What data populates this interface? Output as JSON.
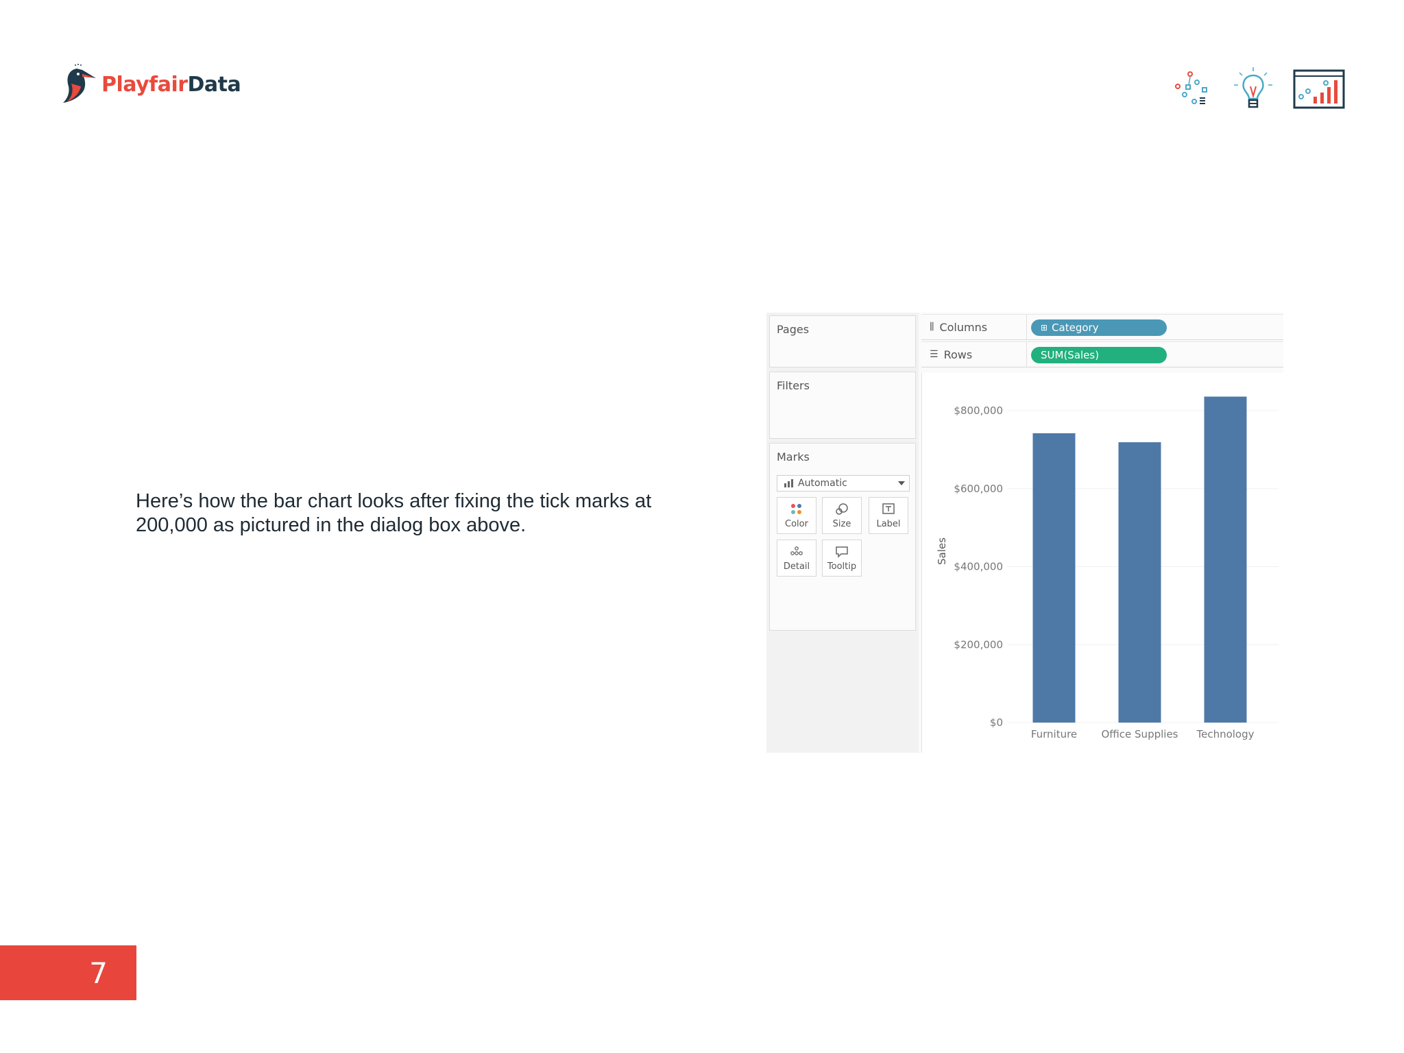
{
  "brand": {
    "name_part1": "Playfair",
    "name_part2": "Data"
  },
  "body_text": "Here’s how the bar chart looks after fixing the tick marks at 200,000 as pictured in the dialog box above.",
  "page_number": "7",
  "header_icons": [
    "scatter-network-icon",
    "lightbulb-icon",
    "dashboard-chart-icon"
  ],
  "tableau": {
    "pages_title": "Pages",
    "filters_title": "Filters",
    "marks_title": "Marks",
    "marks_type": "Automatic",
    "mark_buttons": [
      "Color",
      "Size",
      "Label",
      "Detail",
      "Tooltip"
    ],
    "columns_label": "Columns",
    "rows_label": "Rows",
    "columns_pill": "Category",
    "rows_pill": "SUM(Sales)"
  },
  "chart_data": {
    "type": "bar",
    "categories": [
      "Furniture",
      "Office Supplies",
      "Technology"
    ],
    "values": [
      742000,
      719000,
      836000
    ],
    "ylabel": "Sales",
    "ylim": [
      0,
      800000
    ],
    "yticks": [
      0,
      200000,
      400000,
      600000,
      800000
    ],
    "ytick_labels": [
      "$0",
      "$200,000",
      "$400,000",
      "$600,000",
      "$800,000"
    ],
    "bar_color": "#4e79a7",
    "grid": true
  },
  "colors": {
    "accent": "#e8463d",
    "navy": "#1f3a4a",
    "teal_pill": "#4a98b6",
    "green_pill": "#22b07e"
  }
}
